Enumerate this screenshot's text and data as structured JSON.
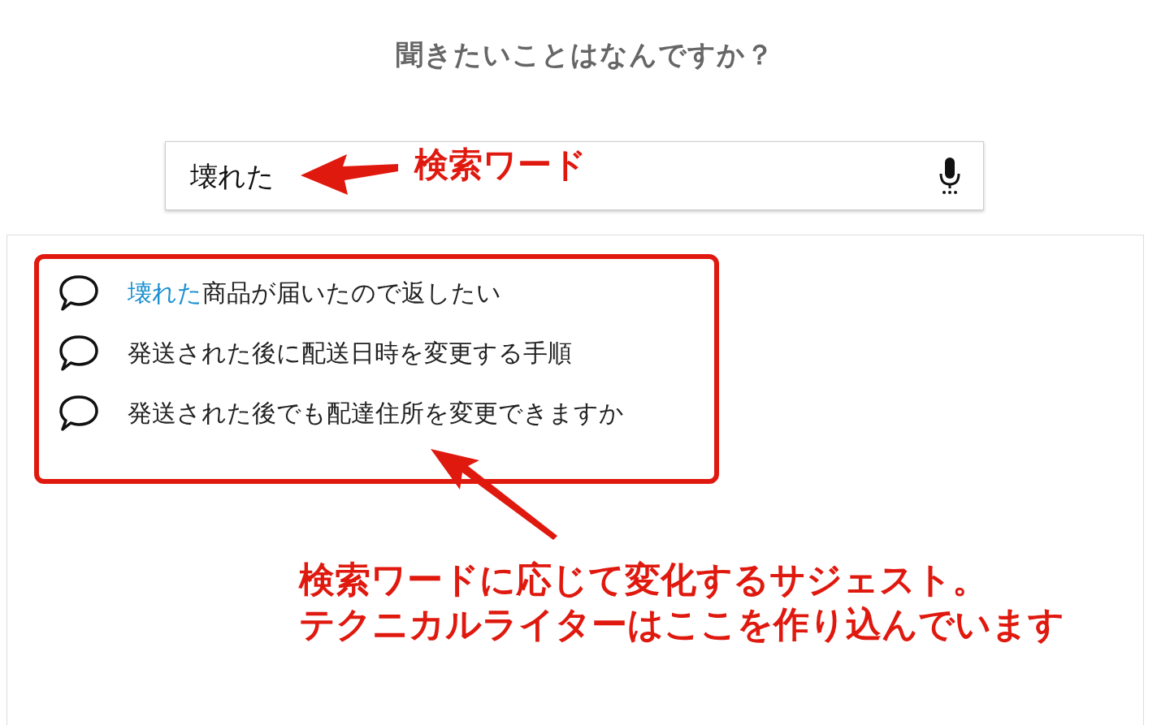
{
  "heading": "聞きたいことはなんですか？",
  "search": {
    "value": "壊れた"
  },
  "suggestions": [
    {
      "match": "壊れた",
      "text": "商品が届いたので返したい"
    },
    {
      "text": "発送された後に配送日時を変更する手順"
    },
    {
      "text": "発送された後でも配達住所を変更できますか"
    }
  ],
  "annotations": [
    {
      "kind": "label",
      "text": "検索ワード"
    },
    {
      "kind": "callout",
      "lines": [
        "検索ワードに応じて変化するサジェスト。",
        "テクニカルライターはここを作り込んでいます"
      ]
    }
  ]
}
